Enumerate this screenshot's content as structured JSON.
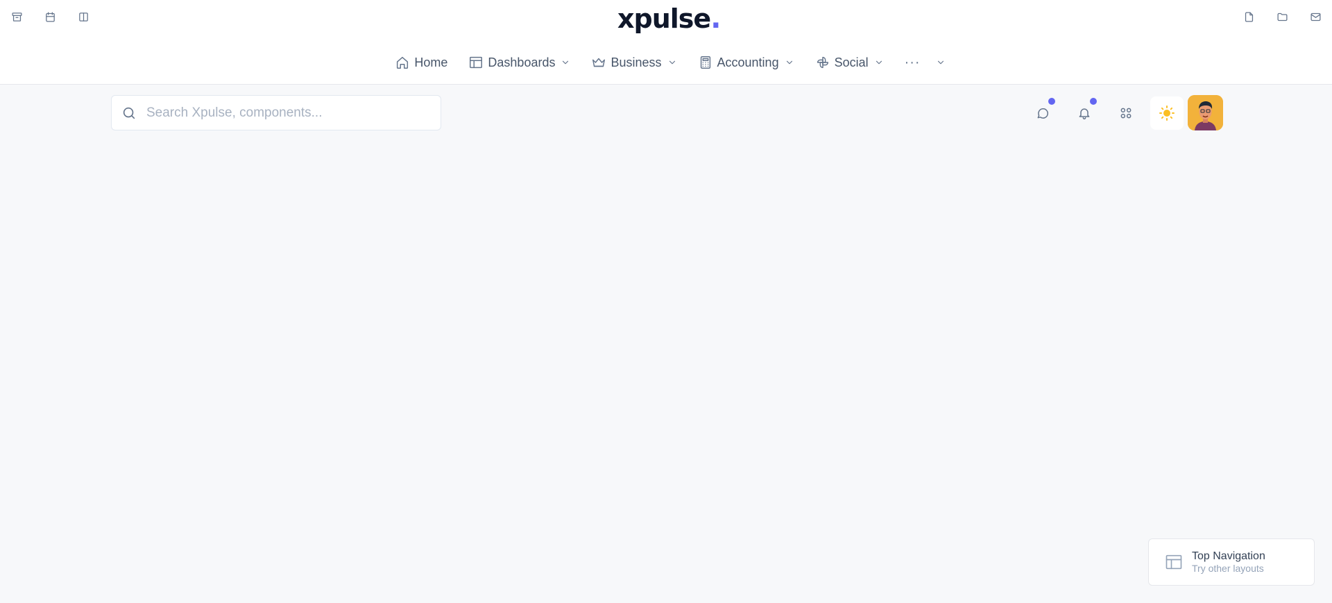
{
  "brand": {
    "logo_main": "pulse",
    "logo_x": "x",
    "logo_dot": "."
  },
  "quick_left": [
    {
      "icon": "archive-icon"
    },
    {
      "icon": "calendar-icon"
    },
    {
      "icon": "columns-icon"
    }
  ],
  "quick_right": [
    {
      "icon": "file-icon"
    },
    {
      "icon": "folder-icon"
    },
    {
      "icon": "mail-icon"
    }
  ],
  "nav": {
    "home": "Home",
    "dashboards": "Dashboards",
    "business": "Business",
    "accounting": "Accounting",
    "social": "Social",
    "more": "···"
  },
  "search": {
    "placeholder": "Search Xpulse, components..."
  },
  "header_actions": {
    "messages_unread": true,
    "notifications_unread": true,
    "accent_color": "#6366f1",
    "theme_icon": "sun-icon"
  },
  "layout_switcher": {
    "title": "Top Navigation",
    "subtitle": "Try other layouts"
  }
}
